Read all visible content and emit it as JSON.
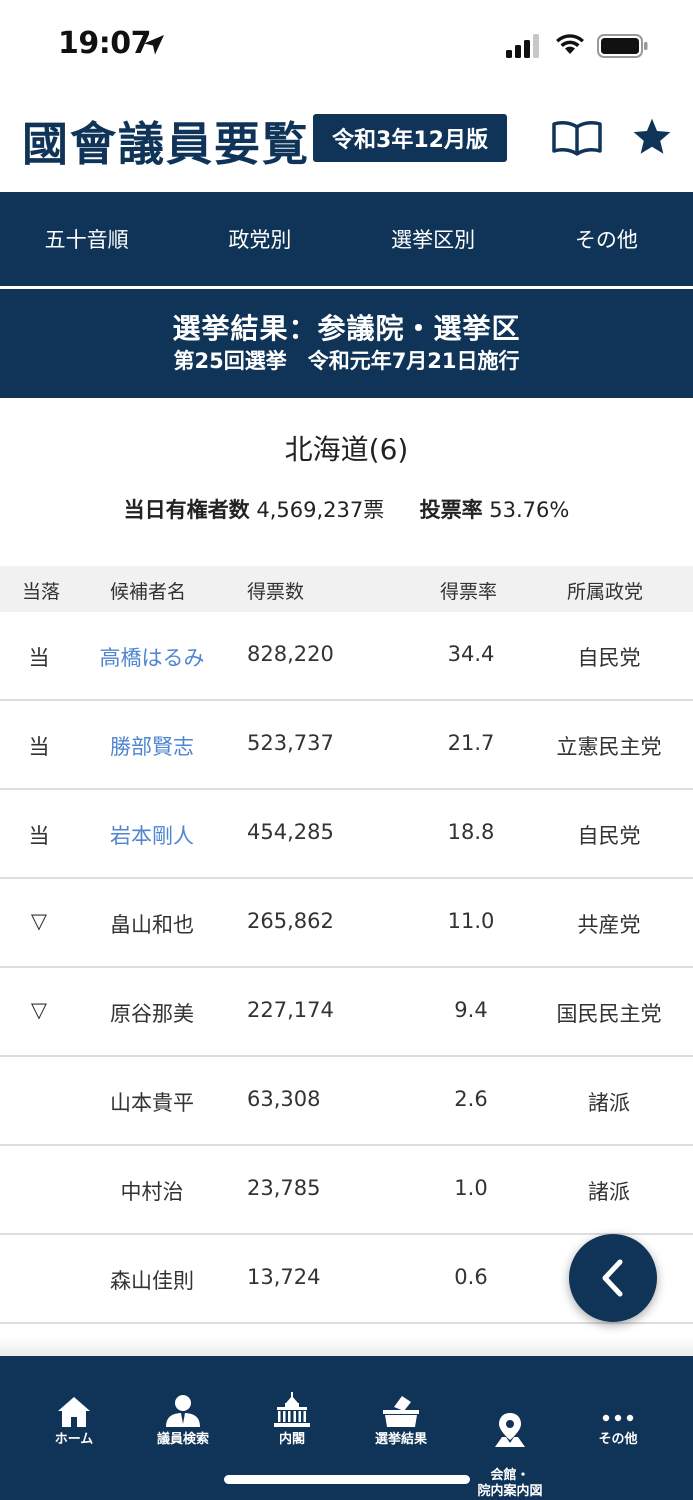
{
  "status_bar": {
    "time": "19:07"
  },
  "header": {
    "title": "國會議員要覧",
    "edition": "令和3年12月版"
  },
  "nav_tabs": [
    "五十音順",
    "政党別",
    "選挙区別",
    "その他"
  ],
  "result_header": {
    "title": "選挙結果：参議院・選挙区",
    "subtitle": "第25回選挙　令和元年7月21日施行"
  },
  "district": {
    "name": "北海道(6)",
    "voters_label": "当日有権者数",
    "voters_value": "4,569,237票",
    "turnout_label": "投票率",
    "turnout_value": "53.76%"
  },
  "table": {
    "headers": {
      "result": "当落",
      "name": "候補者名",
      "votes": "得票数",
      "rate": "得票率",
      "party": "所属政党"
    },
    "rows": [
      {
        "result": "当",
        "name": "高橋はるみ",
        "votes": "828,220",
        "rate": "34.4",
        "party": "自民党",
        "link": true
      },
      {
        "result": "当",
        "name": "勝部賢志",
        "votes": "523,737",
        "rate": "21.7",
        "party": "立憲民主党",
        "link": true
      },
      {
        "result": "当",
        "name": "岩本剛人",
        "votes": "454,285",
        "rate": "18.8",
        "party": "自民党",
        "link": true
      },
      {
        "result": "▽",
        "name": "畠山和也",
        "votes": "265,862",
        "rate": "11.0",
        "party": "共産党",
        "link": false
      },
      {
        "result": "▽",
        "name": "原谷那美",
        "votes": "227,174",
        "rate": "9.4",
        "party": "国民民主党",
        "link": false
      },
      {
        "result": "",
        "name": "山本貴平",
        "votes": "63,308",
        "rate": "2.6",
        "party": "諸派",
        "link": false
      },
      {
        "result": "",
        "name": "中村治",
        "votes": "23,785",
        "rate": "1.0",
        "party": "諸派",
        "link": false
      },
      {
        "result": "",
        "name": "森山佳則",
        "votes": "13,724",
        "rate": "0.6",
        "party": "",
        "link": false
      }
    ]
  },
  "tab_bar": {
    "items": [
      {
        "label": "ホーム",
        "icon": "home-icon"
      },
      {
        "label": "議員検索",
        "icon": "person-icon"
      },
      {
        "label": "内閣",
        "icon": "diet-building-icon"
      },
      {
        "label": "選挙結果",
        "icon": "ballot-box-icon"
      },
      {
        "label": "会館・\n院内案内図",
        "icon": "map-pin-icon"
      },
      {
        "label": "その他",
        "icon": "more-icon"
      }
    ]
  },
  "colors": {
    "navy": "#0f3458",
    "link": "#4f86cf"
  }
}
